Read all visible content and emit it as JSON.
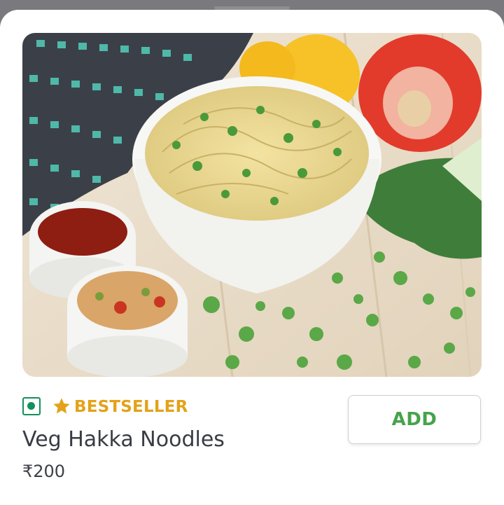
{
  "item": {
    "image_alt": "Bowl of veg hakka noodles with chutney, soup, peppers and spring onions",
    "veg_indicator": "veg-icon",
    "badge_icon": "star-icon",
    "badge_label": "BESTSELLER",
    "name": "Veg Hakka Noodles",
    "price": "₹200"
  },
  "actions": {
    "add_label": "ADD"
  },
  "colors": {
    "veg_green": "#14905a",
    "bestseller_gold": "#e3a21a",
    "add_green": "#46a34b",
    "text_dark": "#3a3c45"
  }
}
